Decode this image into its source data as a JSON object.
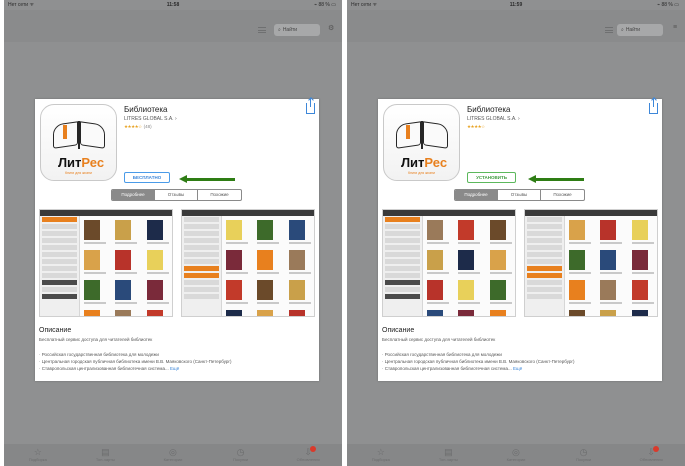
{
  "status": {
    "left": {
      "carrier": "Нет сети ᯤ",
      "time": "11:58",
      "battery": "⌁ 88 % ▭"
    },
    "right": {
      "carrier": "Нет сети ᯤ",
      "time": "11:59",
      "battery": "⌁ 88 % ▭"
    }
  },
  "search": {
    "placeholder": "Найти"
  },
  "app": {
    "title": "Библиотека",
    "publisher": "LITRES GLOBAL S.A. ›",
    "stars": "★★★★☆",
    "rating_count": "(48)",
    "logo": {
      "main": "Лит",
      "accent": "Рес",
      "tagline": "Книги для жизни"
    }
  },
  "buttons": {
    "install_left": "БЕСПЛАТНО",
    "install_right": "УСТАНОВИТЬ"
  },
  "segments": [
    "Подробнее",
    "Отзывы",
    "Похожие"
  ],
  "description": {
    "title": "Описание",
    "subtitle": "Бесплатный сервис доступа для читателей библиотек",
    "lines": [
      "· Российская государственная библиотека для молодежи",
      "· Центральная городская публичная библиотека имени В.В. Маяковского (Санкт-Петербург)",
      "· Ставропольская централизованная библиотечная система..."
    ],
    "more": "Ещё"
  },
  "tabs": [
    "Подборка",
    "Топ-чарты",
    "Категории",
    "Покупки",
    "Обновления"
  ],
  "colors": {
    "arrow": "#2e7d14",
    "install_free": "#3d87d9",
    "install_set": "#3e9b3e",
    "logo_accent": "#e8801e",
    "badge": "#d93a2b",
    "book_covers": [
      "#6b4a2a",
      "#c9a04a",
      "#1d2b4a",
      "#d9a24a",
      "#b8332a",
      "#e8d05a",
      "#3d6a2a",
      "#2a4a7a",
      "#7a2a3a",
      "#e8801e",
      "#9a7a5a",
      "#c23a2a"
    ]
  },
  "icons": [
    "list-icon",
    "search-icon",
    "gear-icon",
    "share-icon",
    "arrow-left-icon",
    "star-icon",
    "grid-icon",
    "compass-icon",
    "clock-icon",
    "download-icon"
  ]
}
